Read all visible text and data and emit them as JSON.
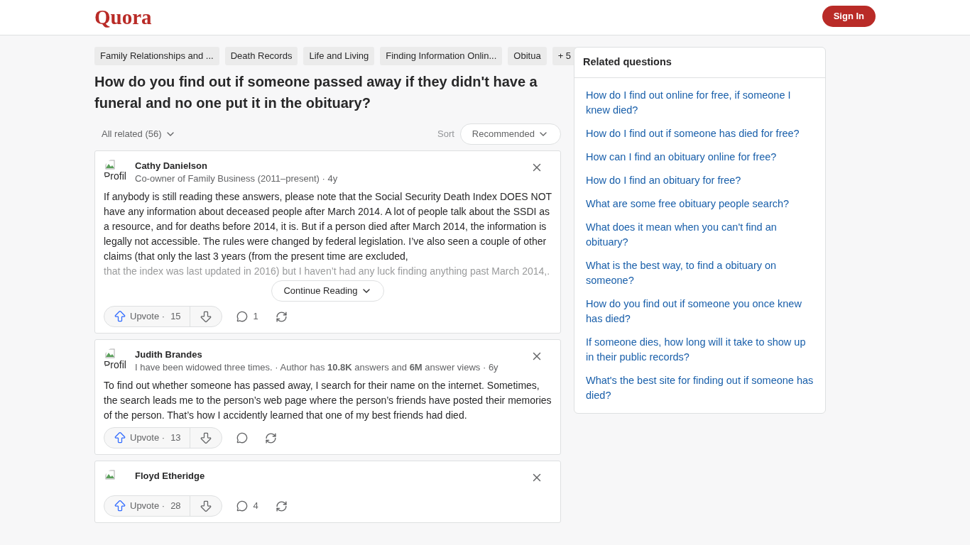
{
  "header": {
    "logo": "Quora",
    "sign_in": "Sign In"
  },
  "topics": [
    {
      "label": "Family Relationships and ..."
    },
    {
      "label": "Death Records"
    },
    {
      "label": "Life and Living"
    },
    {
      "label": "Finding Information Onlin..."
    },
    {
      "label": "Obitua"
    }
  ],
  "topics_more": "+ 5",
  "question": "How do you find out if someone passed away if they didn't have a funeral and no one put it in the obituary?",
  "filter": {
    "label": "All related (56)",
    "sort_label": "Sort",
    "sort_value": "Recommended"
  },
  "answers": [
    {
      "author": "Cathy Danielson",
      "avatar_alt": "Profil",
      "credential": "Co-owner of Family Business (2011–present) · 4y",
      "body": "If anybody is still reading these answers, please note that the Social Security Death Index DOES NOT have any information about deceased people after March 2014. A lot of people talk about the SSDI as a resource, and for deaths before 2014, it is. But if a person died after March 2014, the information is legally not accessible. The rules were changed by federal legislation. I’ve also seen a couple of other claims (that only the last 3 years (from the present time are excluded,",
      "faded": "that the index was last updated in 2016) but I haven’t had any luck finding anything past March 2014,.",
      "continue": "Continue Reading",
      "upvote": "Upvote ·",
      "upvotes": "15",
      "comments": "1"
    },
    {
      "author": "Judith Brandes",
      "avatar_alt": "Profil",
      "credential": "I have been widowed three times. · Author has **10.8K** answers and **6M** answer views · 6y",
      "body": "To find out whether someone has passed away, I search for their name on the internet. Sometimes, the search leads me to the person’s web page where the person’s friends have posted their memories of the person. That’s how I accidently learned that one of my best friends had died.",
      "upvote": "Upvote ·",
      "upvotes": "13"
    },
    {
      "author": "Floyd Etheridge",
      "upvote": "Upvote ·",
      "upvotes": "28",
      "comments": "4"
    }
  ],
  "related": {
    "title": "Related questions",
    "items": [
      "How do I find out online for free, if someone I knew died?",
      "How do I find out if someone has died for free?",
      "How can I find an obituary online for free?",
      "How do I find an obituary for free?",
      "What are some free obituary people search?",
      "What does it mean when you can't find an obituary?",
      "What is the best way, to find a obituary on someone?",
      "How do you find out if someone you once knew has died?",
      "If someone dies, how long will it take to show up in their public records?",
      "What's the best site for finding out if someone has died?"
    ]
  }
}
